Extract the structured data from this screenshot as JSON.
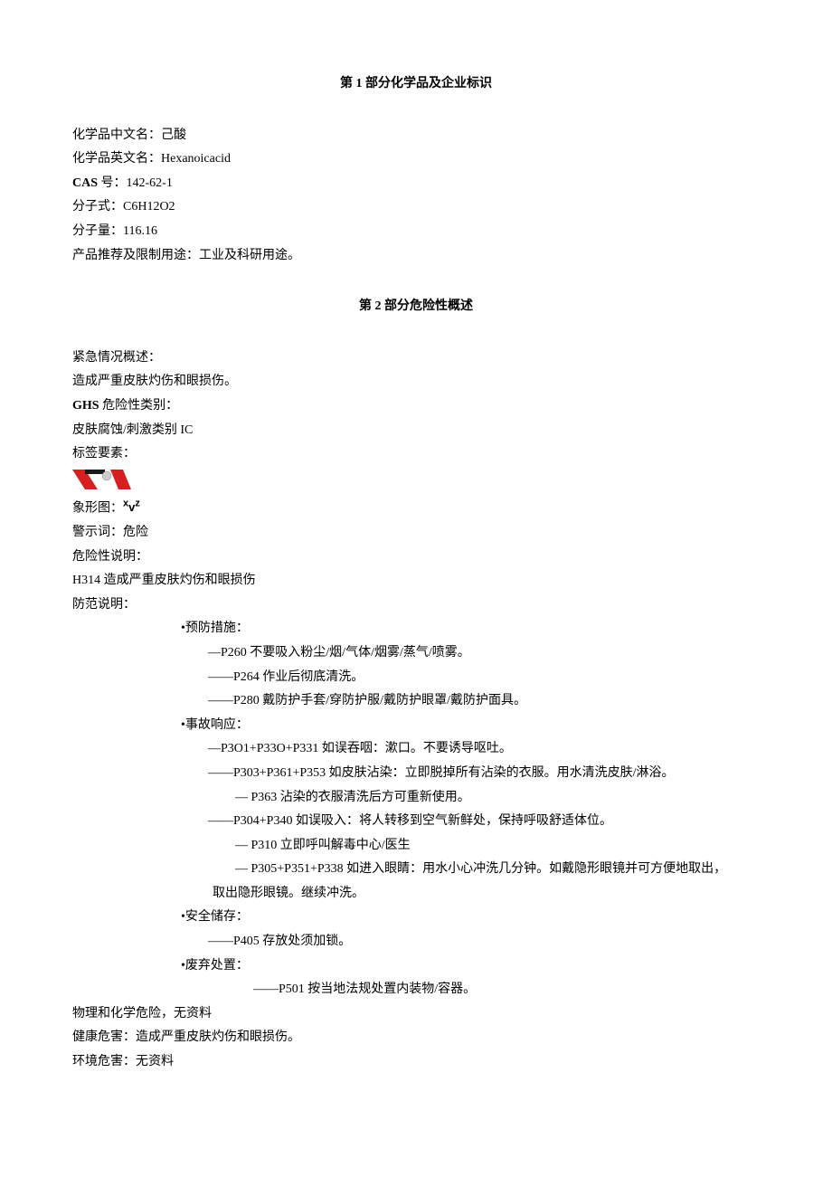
{
  "section1": {
    "title": "第 1 部分化学品及企业标识",
    "cn_name_label": "化学品中文名：己酸",
    "en_name_label": "化学品英文名：Hexanoicacid",
    "cas_prefix": "CAS ",
    "cas_label": "号：142-62-1",
    "formula_label": "分子式：C6H12O2",
    "mw_label": "分子量：116.16",
    "use_label": "产品推荐及限制用途：工业及科研用途。"
  },
  "section2": {
    "title": "第 2 部分危险性概述",
    "emergency_label": "紧急情况概述：",
    "emergency_text": "造成严重皮肤灼伤和眼损伤。",
    "ghs_prefix": "GHS ",
    "ghs_label": "危险性类别：",
    "ghs_text": "皮肤腐蚀/刺激类别 IC",
    "label_elem": "标签要素：",
    "pictogram_label": "象形图：",
    "xvz": {
      "x": "x",
      "v": "v",
      "z": "z"
    },
    "signal_label": "警示词：危险",
    "hazard_label": "危险性说明：",
    "hazard_text": "H314 造成严重皮肤灼伤和眼损伤",
    "precaution_label": "防范说明：",
    "prevention_heading": "•预防措施：",
    "prevention": [
      "—P260 不要吸入粉尘/烟/气体/烟雾/蒸气/喷雾。",
      "——P264 作业后彻底清洗。",
      "——P280 戴防护手套/穿防护服/戴防护眼罩/戴防护面具。"
    ],
    "response_heading": "•事故响应：",
    "response_line1": "—P3O1+P33O+P331 如误吞咽：漱口。不要诱导呕吐。",
    "response_line2": "——P303+P361+P353 如皮肤沾染：立即脱掉所有沾染的衣服。用水清洗皮肤/淋浴。",
    "response_line3": "—   P363 沾染的衣服清洗后方可重新使用。",
    "response_line4": "——P304+P340 如误吸入：将人转移到空气新鲜处，保持呼吸舒适体位。",
    "response_line5": "—    P310 立即呼叫解毒中心/医生",
    "response_line6": "—    P305+P351+P338 如进入眼睛：用水小心冲洗几分钟。如戴隐形眼镜并可方便地取出，",
    "response_line6_cont": "取出隐形眼镜。继续冲洗。",
    "storage_heading": "•安全储存：",
    "storage_line": "——P405 存放处须加锁。",
    "disposal_heading": "•废弃处置：",
    "disposal_line": "——P501 按当地法规处置内装物/容器。",
    "phys_chem": "物理和化学危险，无资料",
    "health": "健康危害：造成严重皮肤灼伤和眼损伤。",
    "env": "环境危害：无资料"
  }
}
